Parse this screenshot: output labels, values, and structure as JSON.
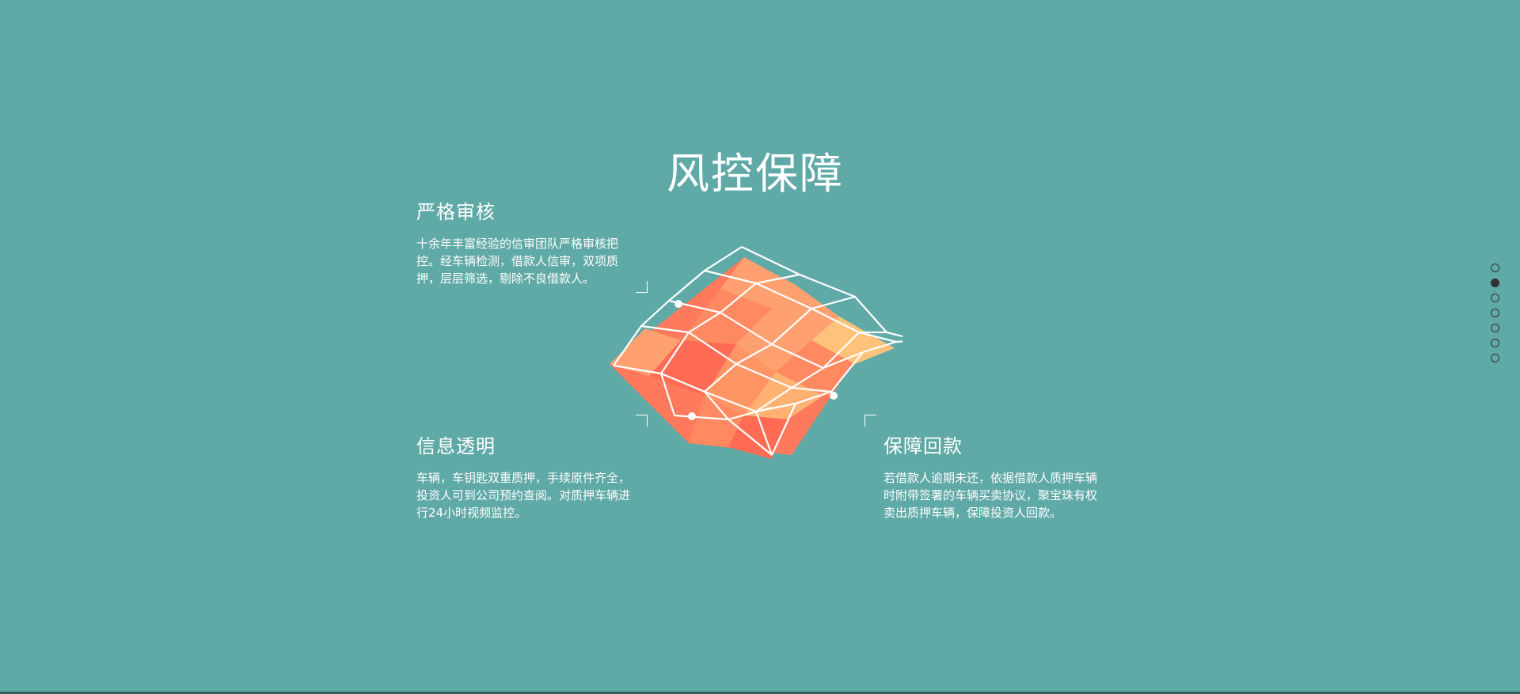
{
  "section": {
    "title": "风控保障"
  },
  "features": {
    "audit": {
      "title": "严格审核",
      "description": "十余年丰富经验的信审团队严格审核把控。经车辆检测，借款人信审，双项质押，层层筛选，剔除不良借款人。"
    },
    "transparency": {
      "title": "信息透明",
      "description": "车辆，车钥匙双重质押，手续原件齐全，投资人可到公司预约查阅。对质押车辆进行24小时视频监控。"
    },
    "repayment": {
      "title": "保障回款",
      "description": "若借款人逾期未还，依据借款人质押车辆时附带签署的车辆买卖协议，聚宝珠有权卖出质押车辆，保障投资人回款。"
    }
  },
  "illustration": {
    "icon": "wireframe-surface-icon",
    "colors": {
      "base": "#ff7a5c",
      "light": "#ffa070",
      "highlight": "#ffc27a",
      "wire": "#ffffff"
    }
  },
  "side_nav": {
    "count": 7,
    "active_index": 1
  },
  "colors": {
    "background": "#5fa9a6",
    "text": "#ffffff",
    "nav_dot": "#333333"
  }
}
